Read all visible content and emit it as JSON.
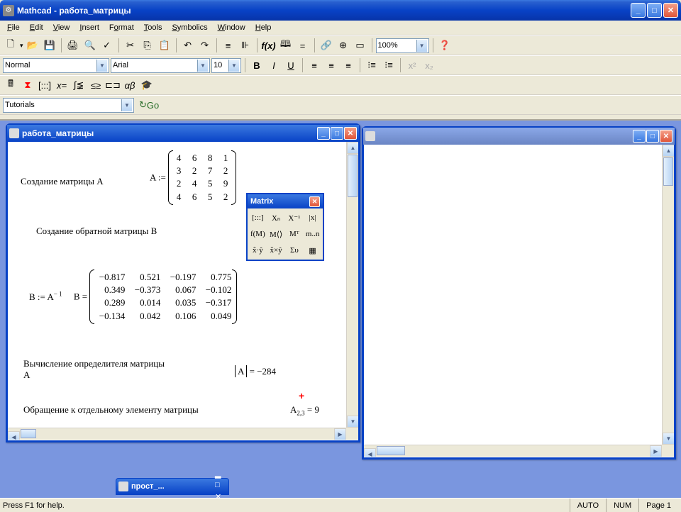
{
  "app": {
    "title": "Mathcad - работа_матрицы"
  },
  "menu": {
    "file": "File",
    "edit": "Edit",
    "view": "View",
    "insert": "Insert",
    "format": "Format",
    "tools": "Tools",
    "symbolics": "Symbolics",
    "window": "Window",
    "help": "Help"
  },
  "toolbar2": {
    "style": "Normal",
    "font": "Arial",
    "size": "10"
  },
  "toolbar1": {
    "zoom": "100%"
  },
  "toolbar4": {
    "nav": "Tutorials",
    "go": "Go"
  },
  "childwin1": {
    "title": "работа_матрицы"
  },
  "palette": {
    "title": "Matrix"
  },
  "math": {
    "create_a": "Создание  матрицы А",
    "a_assign": "A :=",
    "matrix_a": [
      [
        "4",
        "6",
        "8",
        "1"
      ],
      [
        "3",
        "2",
        "7",
        "2"
      ],
      [
        "2",
        "4",
        "5",
        "9"
      ],
      [
        "4",
        "6",
        "5",
        "2"
      ]
    ],
    "create_b": "Создание обратной  матрицы В",
    "b_assign": "B := A",
    "b_exp": "− 1",
    "b_eq": "B =",
    "matrix_b": [
      [
        "−0.817",
        "0.521",
        "−0.197",
        "0.775"
      ],
      [
        "0.349",
        "−0.373",
        "0.067",
        "−0.102"
      ],
      [
        "0.289",
        "0.014",
        "0.035",
        "−0.317"
      ],
      [
        "−0.134",
        "0.042",
        "0.106",
        "0.049"
      ]
    ],
    "det_label": "Вычисление определителя матрицы А",
    "det_val": "= −284",
    "det_sym": "A",
    "elem_label": "Обращение к отдельному элементу матрицы",
    "elem": "A",
    "elem_sub": "2,3",
    "elem_val": "= 9"
  },
  "minimized": {
    "title": "прост_..."
  },
  "palette_btns": [
    "[:::]",
    "Xₙ",
    "X⁻¹",
    "|x|",
    "f(M)",
    "M⟨⟩",
    "Mᵀ",
    "m..n",
    "x̂·ŷ",
    "x̂×ŷ",
    "Συ",
    "▦"
  ],
  "status": {
    "left": "Press F1 for help.",
    "auto": "AUTO",
    "num": "NUM",
    "page": "Page 1"
  }
}
